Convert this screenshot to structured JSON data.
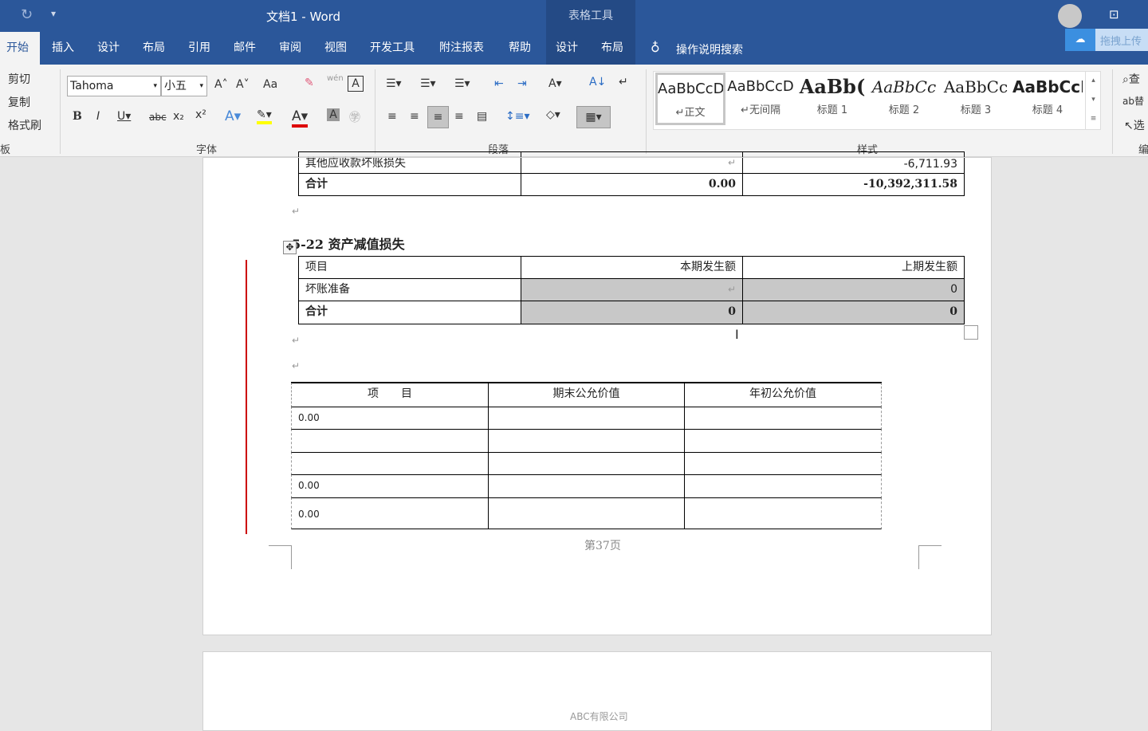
{
  "title": "文档1 - Word",
  "context_tab_group": "表格工具",
  "tabs": [
    "开始",
    "插入",
    "设计",
    "布局",
    "引用",
    "邮件",
    "审阅",
    "视图",
    "开发工具",
    "附注报表",
    "帮助",
    "设计",
    "布局"
  ],
  "search_label": "操作说明搜索",
  "upload_label": "拖拽上传",
  "clipboard": {
    "cut": "剪切",
    "copy": "复制",
    "format_painter": "格式刷",
    "group": "板"
  },
  "font": {
    "name": "Tahoma",
    "size": "小五",
    "group": "字体",
    "change_case": "Aa",
    "wen": "wén"
  },
  "paragraph": {
    "group": "段落"
  },
  "styles": {
    "group": "样式",
    "items": [
      {
        "preview": "AaBbCcD",
        "name": "↵正文"
      },
      {
        "preview": "AaBbCcD",
        "name": "↵无间隔"
      },
      {
        "preview": "AaBb(",
        "name": "标题 1"
      },
      {
        "preview": "AaBbCc",
        "name": "标题 2"
      },
      {
        "preview": "AaBbCc",
        "name": "标题 3"
      },
      {
        "preview": "AaBbCcI",
        "name": "标题 4"
      }
    ]
  },
  "editing": {
    "find": "查",
    "replace": "替",
    "select": "选",
    "group": "编"
  },
  "doc": {
    "table1": {
      "rows": [
        [
          "其他应收款坏账损失",
          "",
          "-6,711.93"
        ],
        [
          "合计",
          "0.00",
          "-10,392,311.58"
        ]
      ]
    },
    "heading": "5-22 资产减值损失",
    "table2": {
      "rows": [
        [
          "项目",
          "本期发生额",
          "上期发生额"
        ],
        [
          "坏账准备",
          "",
          "0"
        ],
        [
          "合计",
          "0",
          "0"
        ]
      ]
    },
    "table3": {
      "header": [
        "项　　目",
        "期末公允价值",
        "年初公允价值"
      ],
      "rows": [
        [
          "0.00",
          "",
          ""
        ],
        [
          "",
          "",
          ""
        ],
        [
          "",
          "",
          ""
        ],
        [
          "0.00",
          "",
          ""
        ],
        [
          "0.00",
          "",
          ""
        ]
      ]
    },
    "footer": "第37页",
    "next_header": "ABC有限公司"
  }
}
